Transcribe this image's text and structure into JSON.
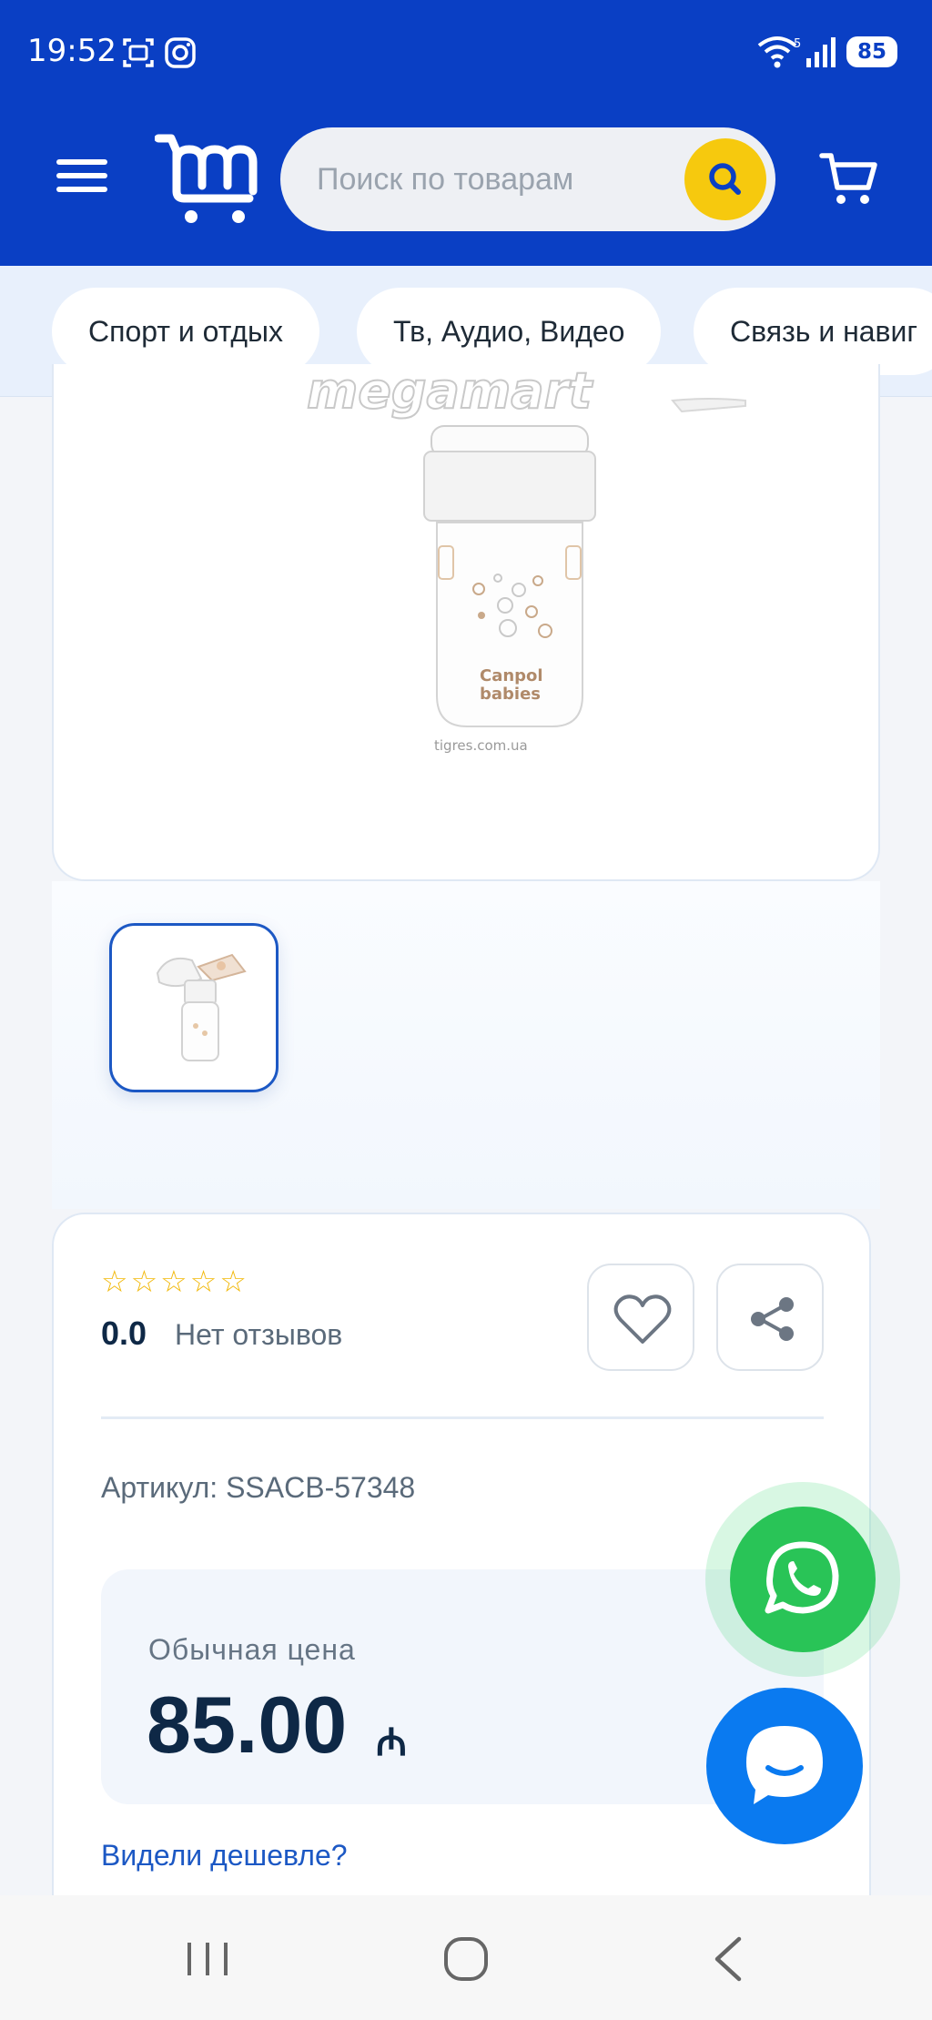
{
  "status_bar": {
    "time": "19:52",
    "battery": "85",
    "icons": [
      "screenshot-icon",
      "instagram-icon",
      "wifi-icon",
      "signal-icon"
    ]
  },
  "header": {
    "logo": "megamart-logo",
    "search_placeholder": "Поиск по товарам",
    "accent_color": "#0a3fc4",
    "search_button_color": "#f6c90e"
  },
  "categories": [
    {
      "label": "Спорт и отдых"
    },
    {
      "label": "Тв, Аудио, Видео"
    },
    {
      "label": "Связь и навиг"
    }
  ],
  "product": {
    "image_watermark": "megamart",
    "image_source": "tigres.com.ua",
    "bottle_brand": "Canpol babies",
    "rating_stars": 0,
    "rating_value": "0.0",
    "reviews_text": "Нет отзывов",
    "sku": "Артикул: SSACB-57348",
    "price_label": "Обычная цена",
    "price_value": "85.00",
    "currency": "₼",
    "cheaper_link": "Видели дешевле?"
  },
  "floating": {
    "whatsapp_color": "#29c457",
    "chat_color": "#0a7af0"
  },
  "nav": [
    "recent-apps-icon",
    "home-icon",
    "back-icon"
  ]
}
